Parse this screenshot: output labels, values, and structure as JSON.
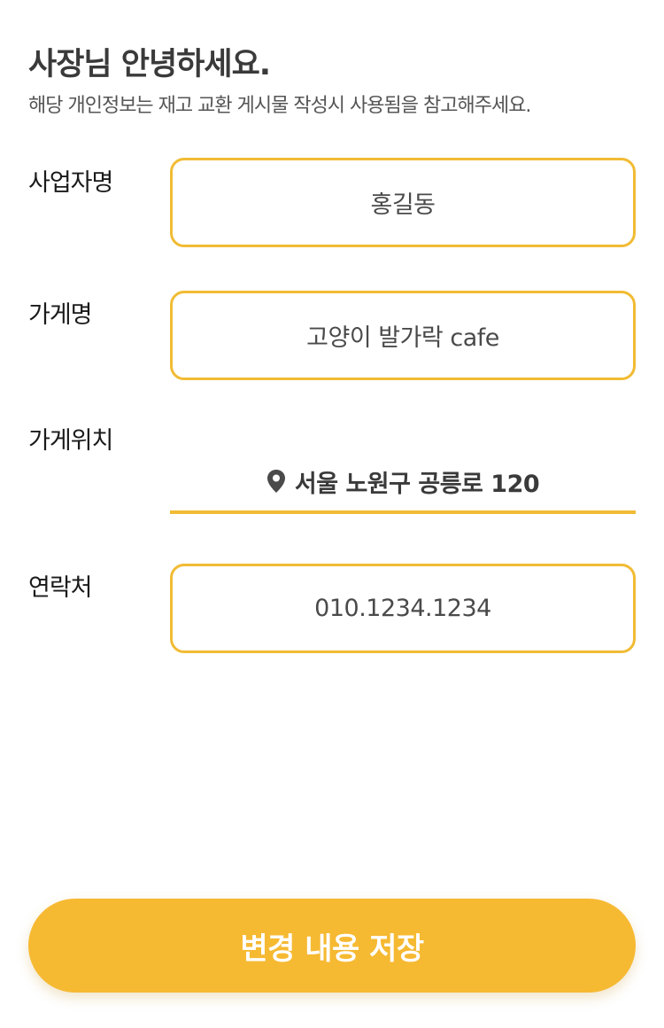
{
  "header": {
    "title": "사장님 안녕하세요.",
    "subtitle": "해당 개인정보는 재고 교환 게시물 작성시 사용됨을 참고해주세요."
  },
  "form": {
    "owner_name": {
      "label": "사업자명",
      "value": "홍길동"
    },
    "store_name": {
      "label": "가게명",
      "value": "고양이 발가락 cafe"
    },
    "store_location": {
      "label": "가게위치",
      "value": "서울 노원구 공릉로 120",
      "icon": "location-pin-icon"
    },
    "contact": {
      "label": "연락처",
      "value": "010.1234.1234"
    }
  },
  "actions": {
    "save_label": "변경 내용 저장"
  },
  "colors": {
    "accent": "#f6b932",
    "field_border": "#f1bb34"
  }
}
